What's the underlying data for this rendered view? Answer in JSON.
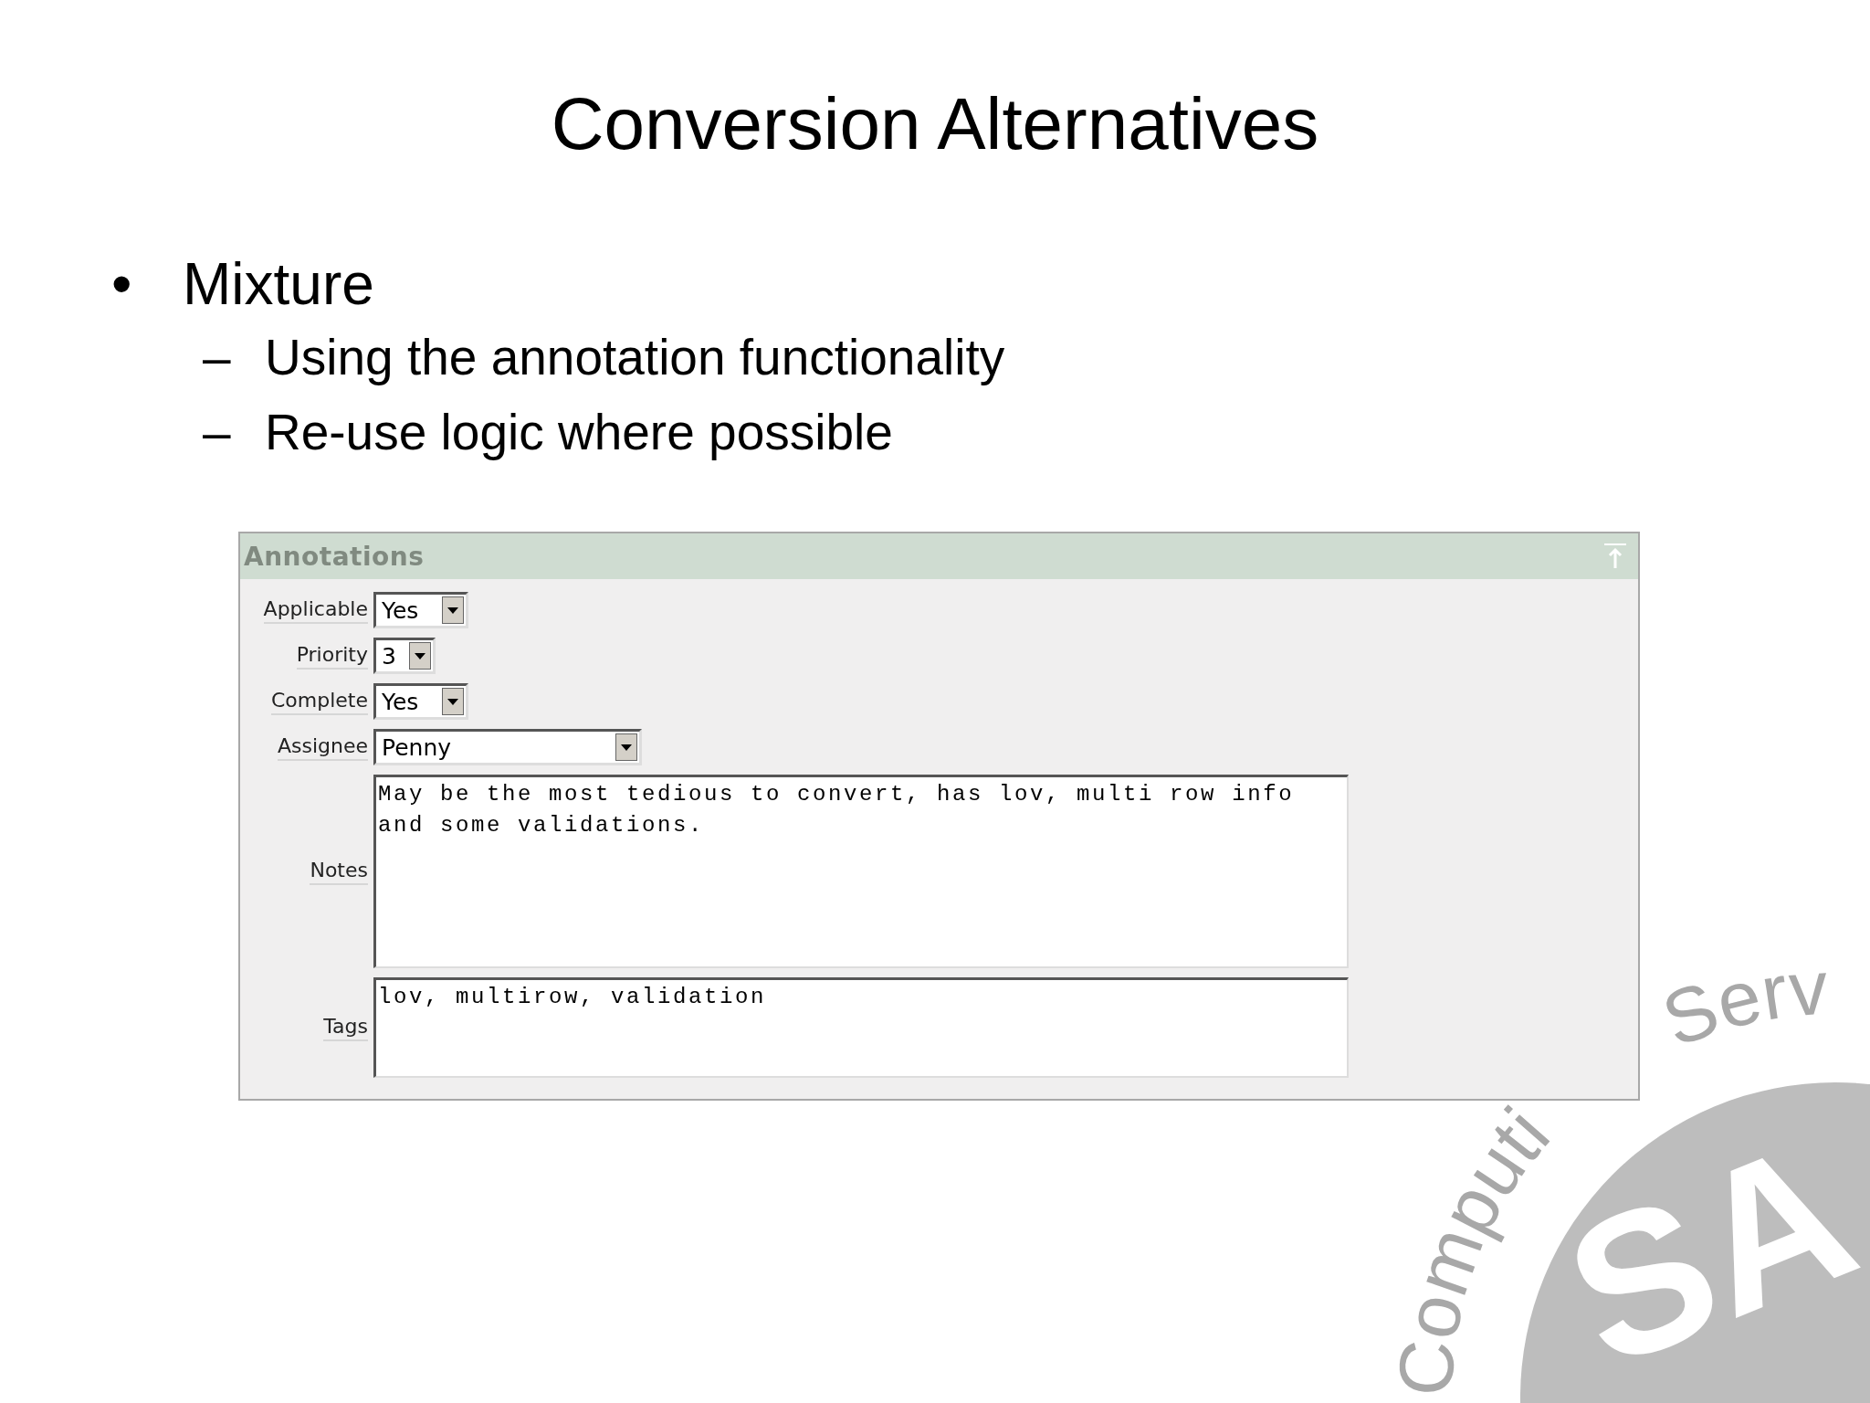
{
  "slide": {
    "title": "Conversion Alternatives",
    "bullets": [
      {
        "marker": "•",
        "text": "Mixture",
        "children": [
          {
            "marker": "–",
            "text": "Using the annotation functionality"
          },
          {
            "marker": "–",
            "text": "Re-use logic where possible"
          }
        ]
      }
    ]
  },
  "panel": {
    "title": "Annotations",
    "fields": [
      {
        "kind": "select",
        "label": "Applicable",
        "value": "Yes"
      },
      {
        "kind": "select",
        "label": "Priority",
        "value": "3"
      },
      {
        "kind": "select",
        "label": "Complete",
        "value": "Yes"
      },
      {
        "kind": "select",
        "label": "Assignee",
        "value": "Penny"
      },
      {
        "kind": "textarea",
        "label": "Notes",
        "value": "May be the most tedious to convert, has lov, multi row info\nand some validations."
      },
      {
        "kind": "textarea",
        "label": "Tags",
        "value": "lov, multirow, validation"
      }
    ]
  },
  "logo": {
    "ring_texts": [
      "Computi",
      "Serv"
    ],
    "letters": "SA"
  }
}
